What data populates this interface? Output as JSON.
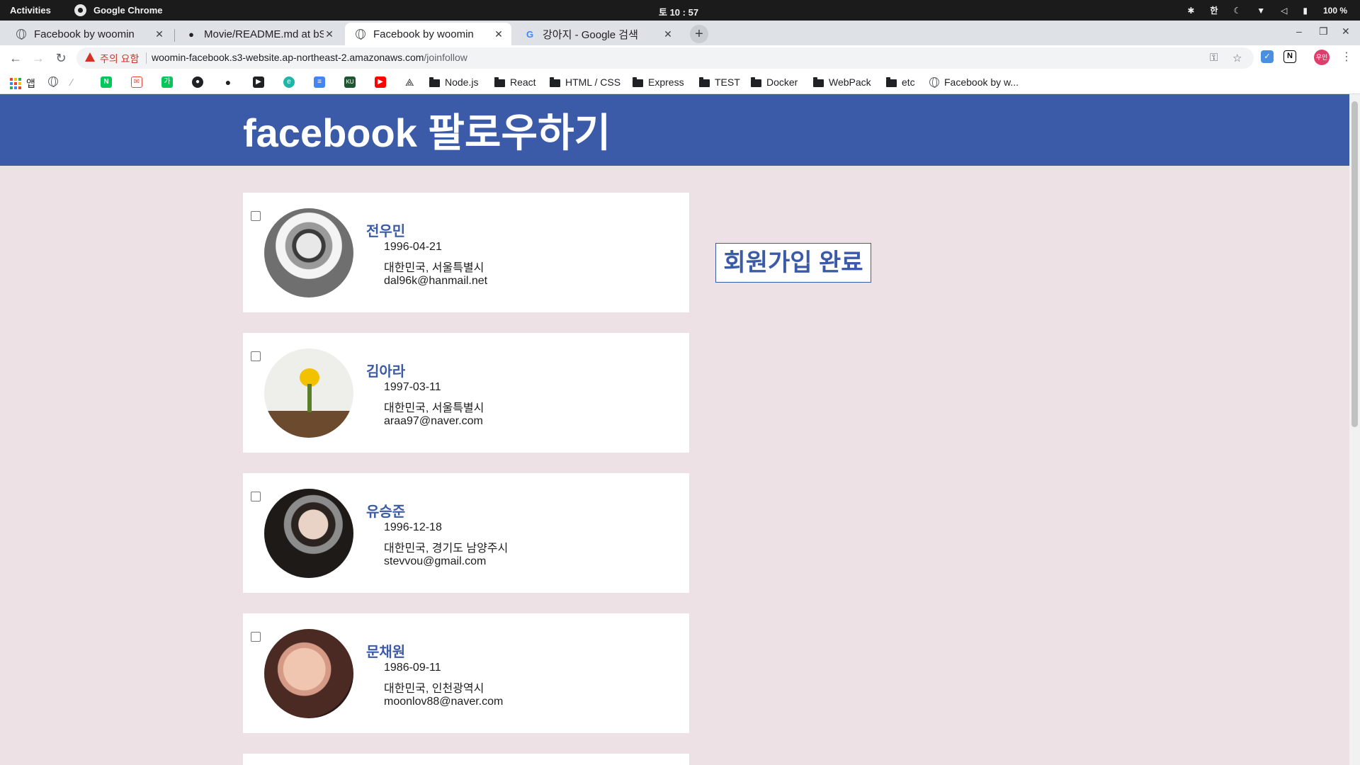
{
  "os_bar": {
    "activities": "Activities",
    "app_name": "Google Chrome",
    "clock": "토 10 : 57",
    "ime": "한",
    "battery": "100 %"
  },
  "tabs": [
    {
      "title": "Facebook by woomin",
      "icon": "globe-icon",
      "active": false
    },
    {
      "title": "Movie/README.md at bS",
      "icon": "github-icon",
      "active": false
    },
    {
      "title": "Facebook by woomin",
      "icon": "globe-icon",
      "active": true
    },
    {
      "title": "강아지 - Google 검색",
      "icon": "google-icon",
      "active": false
    }
  ],
  "address_bar": {
    "security_label": "주의 요함",
    "url_host": "woomin-facebook.s3-website.ap-northeast-2.amazonaws.com",
    "url_path": "/joinfollow"
  },
  "bookmarks": {
    "apps_label": "앱",
    "folders": [
      "Node.js",
      "React",
      "HTML / CSS",
      "Express",
      "TEST",
      "Docker",
      "WebPack",
      "etc"
    ],
    "last_item": "Facebook by w..."
  },
  "profile_chip": "우민",
  "page": {
    "title": "facebook 팔로우하기",
    "join_done_label": "회원가입 완료",
    "people": [
      {
        "name": "전우민",
        "birth": "1996-04-21",
        "location": "대한민국, 서울특별시",
        "email": "dal96k@hanmail.net"
      },
      {
        "name": "김아라",
        "birth": "1997-03-11",
        "location": "대한민국, 서울특별시",
        "email": "araa97@naver.com"
      },
      {
        "name": "유승준",
        "birth": "1996-12-18",
        "location": "대한민국, 경기도 남양주시",
        "email": "stevvou@gmail.com"
      },
      {
        "name": "문채원",
        "birth": "1986-09-11",
        "location": "대한민국, 인천광역시",
        "email": "moonlov88@naver.com"
      }
    ]
  },
  "colors": {
    "facebook_blue": "#3b5ba9",
    "page_background": "#ede1e6",
    "warning_red": "#d93025"
  }
}
